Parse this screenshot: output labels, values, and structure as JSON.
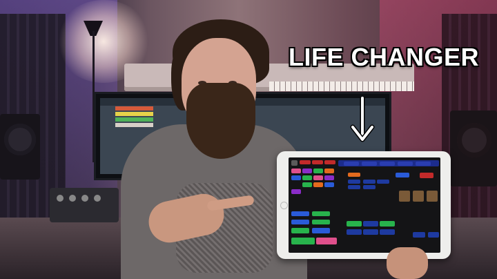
{
  "headline": "LIFE CHANGER",
  "colors": {
    "screen_bg": "#141416",
    "topbar": "#1c2c8c",
    "blue": "#2a5bd8",
    "green": "#28b34c",
    "pink": "#e0508c",
    "orange": "#e36a1e",
    "purple": "#8a2cc8",
    "dark_blue": "#1e3aa0",
    "brown": "#7a5a38"
  },
  "icons": {
    "arrow": "arrow-down-icon",
    "home_button": "home-button-icon"
  },
  "tablet_buttons": [
    {
      "name": "btn-top-1",
      "color": "#5a5a5a"
    },
    {
      "name": "btn-top-2",
      "color": "#c22a2a"
    },
    {
      "name": "btn-top-3",
      "color": "#c22a2a"
    },
    {
      "name": "btn-top-4",
      "color": "#c22a2a"
    },
    {
      "name": "btn-topbar-1",
      "color": "#2a3db0"
    },
    {
      "name": "btn-topbar-2",
      "color": "#2a3db0"
    },
    {
      "name": "btn-topbar-3",
      "color": "#2a3db0"
    },
    {
      "name": "btn-topbar-4",
      "color": "#2a3db0"
    },
    {
      "name": "btn-topbar-5",
      "color": "#2a3db0"
    },
    {
      "name": "btn-pad-1",
      "color": "#e0508c"
    },
    {
      "name": "btn-pad-2",
      "color": "#8a2cc8"
    },
    {
      "name": "btn-pad-3",
      "color": "#28b34c"
    },
    {
      "name": "btn-pad-4",
      "color": "#e36a1e"
    },
    {
      "name": "btn-pad-5",
      "color": "#2a5bd8"
    },
    {
      "name": "btn-pad-6",
      "color": "#28b34c"
    },
    {
      "name": "btn-pad-7",
      "color": "#e0508c"
    },
    {
      "name": "btn-pad-8",
      "color": "#8a2cc8"
    },
    {
      "name": "btn-pad-9",
      "color": "#28b34c"
    },
    {
      "name": "btn-pad-10",
      "color": "#e36a1e"
    },
    {
      "name": "btn-pad-11",
      "color": "#2a5bd8"
    },
    {
      "name": "btn-pad-12",
      "color": "#8a2cc8"
    },
    {
      "name": "btn-mid-1",
      "color": "#e36a1e"
    },
    {
      "name": "btn-mid-2",
      "color": "#1e3aa0"
    },
    {
      "name": "btn-mid-3",
      "color": "#1e3aa0"
    },
    {
      "name": "btn-mid-4",
      "color": "#1e3aa0"
    },
    {
      "name": "btn-mid-5",
      "color": "#1e3aa0"
    },
    {
      "name": "btn-mid-6",
      "color": "#1e3aa0"
    },
    {
      "name": "btn-right-1",
      "color": "#2a5bd8"
    },
    {
      "name": "btn-right-2",
      "color": "#c22a2a"
    },
    {
      "name": "btn-grid-1",
      "color": "#7a5a38"
    },
    {
      "name": "btn-grid-2",
      "color": "#7a5a38"
    },
    {
      "name": "btn-grid-3",
      "color": "#7a5a38"
    },
    {
      "name": "btn-bot-1",
      "color": "#2a5bd8"
    },
    {
      "name": "btn-bot-2",
      "color": "#28b34c"
    },
    {
      "name": "btn-bot-3",
      "color": "#2a5bd8"
    },
    {
      "name": "btn-bot-4",
      "color": "#28b34c"
    },
    {
      "name": "btn-bot-5",
      "color": "#28b34c"
    },
    {
      "name": "btn-bot-6",
      "color": "#2a5bd8"
    },
    {
      "name": "btn-bot-7",
      "color": "#28b34c"
    },
    {
      "name": "btn-bot-8",
      "color": "#e0508c"
    },
    {
      "name": "btn-bot-9",
      "color": "#28b34c"
    },
    {
      "name": "btn-bot-10",
      "color": "#1e3aa0"
    },
    {
      "name": "btn-bot-11",
      "color": "#28b34c"
    },
    {
      "name": "btn-bot-12",
      "color": "#1e3aa0"
    },
    {
      "name": "btn-bot-13",
      "color": "#1e3aa0"
    },
    {
      "name": "btn-bot-14",
      "color": "#1e3aa0"
    },
    {
      "name": "btn-bot-15",
      "color": "#1e3aa0"
    },
    {
      "name": "btn-bot-16",
      "color": "#1e3aa0"
    }
  ]
}
